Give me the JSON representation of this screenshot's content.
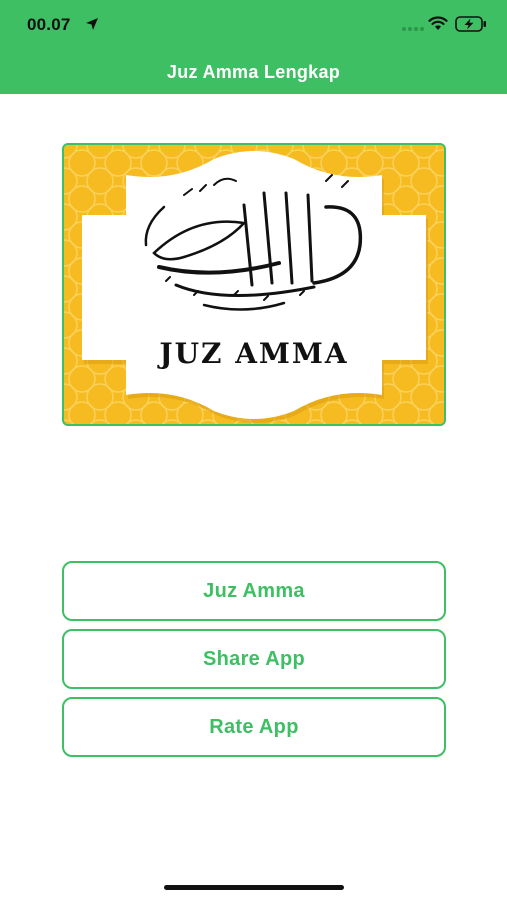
{
  "status_bar": {
    "time": "00.07",
    "location_icon": "location-arrow-icon",
    "signal_icon": "cellular-dots-icon",
    "wifi_icon": "wifi-icon",
    "battery_icon": "battery-charging-icon"
  },
  "nav": {
    "title": "Juz Amma Lengkap"
  },
  "banner": {
    "caption": "JUZ AMMA",
    "image": "al-quran-calligraphy",
    "frame_color": "#3fbf63",
    "background_color": "#f6bb21"
  },
  "buttons": {
    "juz_amma": "Juz Amma",
    "share_app": "Share App",
    "rate_app": "Rate App"
  },
  "colors": {
    "accent": "#3fbf63",
    "background": "#ffffff"
  }
}
